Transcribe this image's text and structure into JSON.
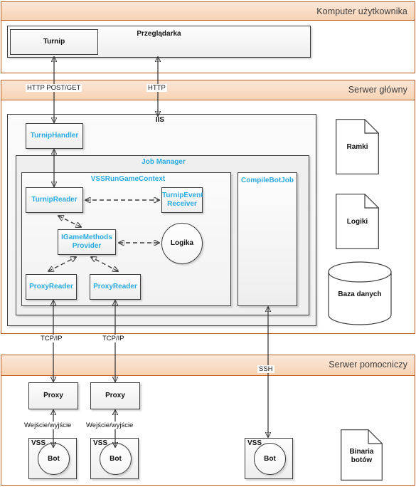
{
  "lanes": [
    {
      "title": "Komputer użytkownika"
    },
    {
      "title": "Serwer główny"
    },
    {
      "title": "Serwer pomocniczy"
    }
  ],
  "client": {
    "browser_label": "Przeglądarka",
    "app_label": "Turnip"
  },
  "edges": {
    "http_post_get": "HTTP POST/GET",
    "http": "HTTP",
    "tcp_ip_left": "TCP/IP",
    "tcp_ip_right": "TCP/IP",
    "ssh": "SSH",
    "io_left": "Wejście/wyjście",
    "io_right": "Wejście/wyjście"
  },
  "server": {
    "iis_label": "IIS",
    "turnip_handler": "TurnipHandler",
    "job_manager": "Job Manager",
    "vss_run_game_context": "VSSRunGameContext",
    "turnip_reader": "TurnipReader",
    "turnip_event_receiver_line1": "TurnipEvent",
    "turnip_event_receiver_line2": "Receiver",
    "igame_methods_line1": "IGameMethods",
    "igame_methods_line2": "Provider",
    "logika": "Logika",
    "proxy_reader_left": "ProxyReader",
    "proxy_reader_right": "ProxyReader",
    "compile_bot_job": "CompileBotJob",
    "artifacts": {
      "ramki": "Ramki",
      "logiki": "Logiki",
      "baza_danych": "Baza danych"
    }
  },
  "aux_server": {
    "proxy_left": "Proxy",
    "proxy_right": "Proxy",
    "vss_left": "VSS",
    "vss_right": "VSS",
    "vss_remote": "VSS",
    "bot_left": "Bot",
    "bot_right": "Bot",
    "bot_remote": "Bot",
    "binaria_line1": "Binaria",
    "binaria_line2": "botów"
  },
  "colors": {
    "lane_border": "#c05a17",
    "lane_fill": "#f8d3b4",
    "class_text": "#29abe2",
    "box_border": "#3b3b3b",
    "connector": "#5a5a5a"
  }
}
